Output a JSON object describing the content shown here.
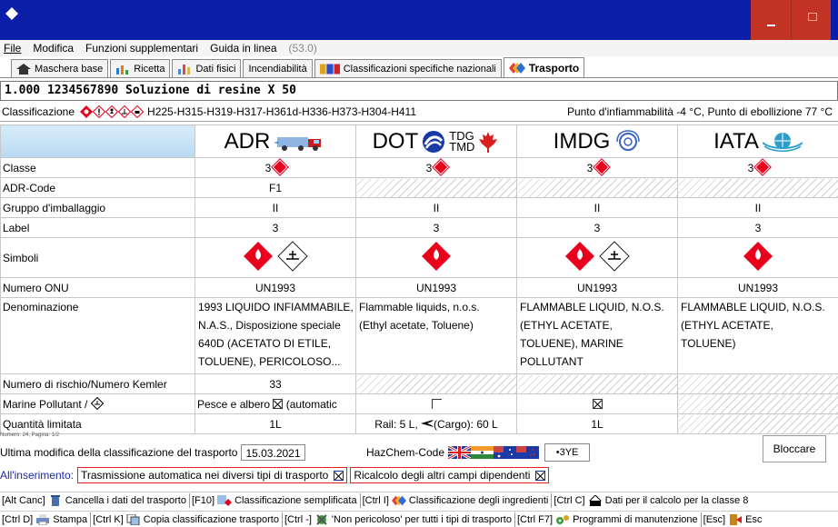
{
  "menu": {
    "items": [
      "File",
      "Modifica",
      "Funzioni supplementari",
      "Guida in linea"
    ],
    "version": "(53.0)"
  },
  "tabs": [
    {
      "label": "Maschera base",
      "icon": "home-icon"
    },
    {
      "label": "Ricetta",
      "icon": "recipe-icon"
    },
    {
      "label": "Dati fisici",
      "icon": "physical-data-icon"
    },
    {
      "label": "Incendiabilità",
      "icon": ""
    },
    {
      "label": "Classificazioni specifiche nazionali",
      "icon": "flags-icon"
    },
    {
      "label": "Trasporto",
      "icon": "transport-icon",
      "active": true
    }
  ],
  "product": {
    "title": "1.000 1234567890 Soluzione di resine X 50"
  },
  "classification": {
    "label": "Classificazione",
    "h_codes": "H225-H315-H319-H317-H361d-H336-H373-H304-H411",
    "flash_info": "Punto d'infiammabilità -4 °C, Punto di ebollizione 77 °C"
  },
  "modes": [
    "ADR",
    "DOT",
    "IMDG",
    "IATA"
  ],
  "dot_sub": [
    "TDG",
    "TMD"
  ],
  "rows": {
    "classe": {
      "label": "Classe",
      "values": [
        "3",
        "3",
        "3",
        "3"
      ]
    },
    "adr_code": {
      "label": "ADR-Code",
      "values": [
        "F1"
      ]
    },
    "gruppo": {
      "label": "Gruppo d'imballaggio",
      "values": [
        "II",
        "II",
        "II",
        "II"
      ]
    },
    "label": {
      "label": "Label",
      "values": [
        "3",
        "3",
        "3",
        "3"
      ]
    },
    "simboli": {
      "label": "Simboli"
    },
    "numero_onu": {
      "label": "Numero ONU",
      "values": [
        "UN1993",
        "UN1993",
        "UN1993",
        "UN1993"
      ]
    },
    "denominazione": {
      "label": "Denominazione",
      "values": [
        [
          "1993 LIQUIDO INFIAMMABILE,",
          "N.A.S., Disposizione speciale",
          "640D (ACETATO DI ETILE,",
          "TOLUENE), PERICOLOSO..."
        ],
        [
          "Flammable liquids, n.o.s.",
          "(Ethyl acetate, Toluene)"
        ],
        [
          "FLAMMABLE LIQUID, N.O.S.",
          "(ETHYL ACETATE,",
          "TOLUENE), MARINE",
          "POLLUTANT"
        ],
        [
          "FLAMMABLE LIQUID, N.O.S.",
          "(ETHYL ACETATE,",
          "TOLUENE)"
        ]
      ]
    },
    "kemler": {
      "label": "Numero di rischio/Numero Kemler",
      "values": [
        "33"
      ]
    },
    "marine": {
      "label": "Marine Pollutant /",
      "adr_text": "Pesce e albero",
      "adr_suffix": "(automatic"
    },
    "quantita": {
      "label": "Quantità limitata",
      "values": [
        "1L",
        "Rail: 5 L,",
        "(Cargo): 60 L",
        "1L"
      ]
    }
  },
  "footnote": "Numero: 24, Pagina: 1/2",
  "last_modified": {
    "label": "Ultima modifica della classificazione del trasporto",
    "date": "15.03.2021"
  },
  "hazchem": {
    "label": "HazChem-Code",
    "value": "•3YE"
  },
  "lock_button": "Bloccare",
  "on_insert": {
    "label": "All'inserimento:",
    "option1": "Trasmissione automatica nei diversi tipi di trasporto",
    "option2": "Ricalcolo degli altri campi dipendenti"
  },
  "fkeys_row1": [
    {
      "key": "[Alt Canc]",
      "label": "Cancella i dati del trasporto"
    },
    {
      "key": "[F10]",
      "label": "Classificazione semplificata"
    },
    {
      "key": "[Ctrl I]",
      "label": "Classificazione degli ingredienti"
    },
    {
      "key": "[Ctrl C]",
      "label": "Dati per il calcolo per la classe 8"
    }
  ],
  "fkeys_row2": [
    {
      "key": "[Ctrl D]",
      "label": "Stampa"
    },
    {
      "key": "[Ctrl K]",
      "label": "Copia classificazione trasporto"
    },
    {
      "key": "[Ctrl -]",
      "label": "'Non pericoloso' per tutti i tipi di trasporto"
    },
    {
      "key": "[Ctrl F7]",
      "label": "Programmi di manutenzione"
    },
    {
      "key": "[Esc]",
      "label": "Esc"
    }
  ],
  "colors": {
    "titlebar": "#0a1ea8",
    "hazard_red": "#e8001c",
    "link_blue": "#1a2aa6"
  }
}
